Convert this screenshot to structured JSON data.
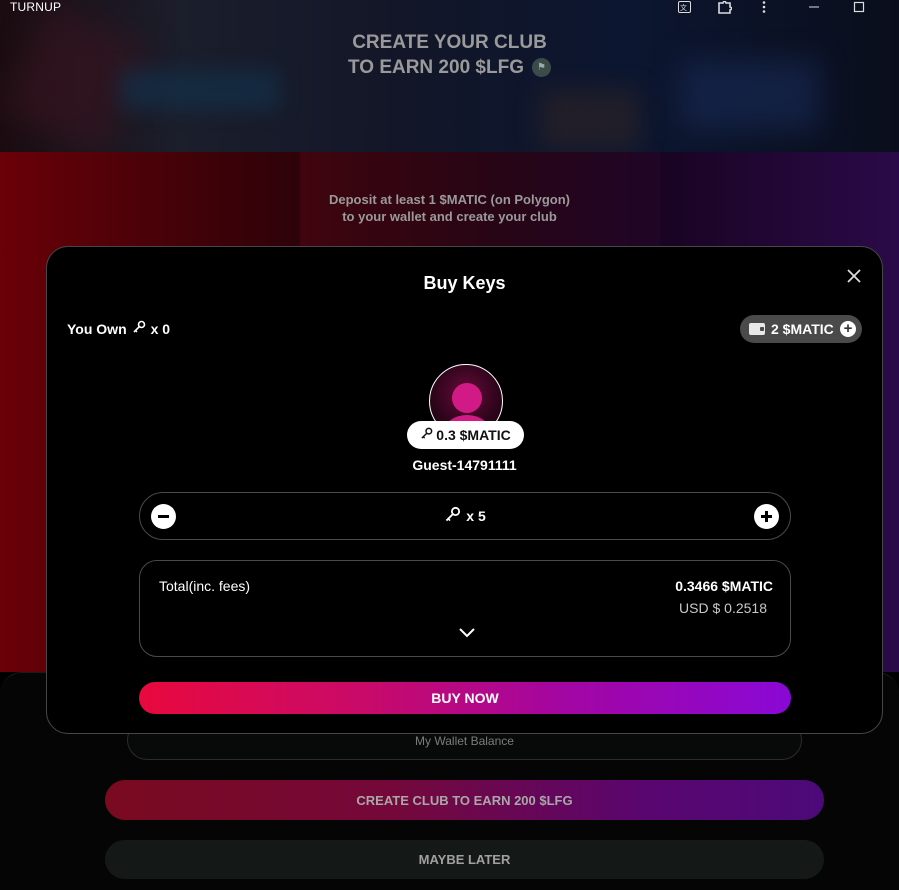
{
  "window": {
    "app_title": "TURNUP",
    "icons": [
      "translate-icon",
      "extension-icon",
      "more-vert-icon",
      "minimize-icon",
      "maximize-icon"
    ]
  },
  "hero": {
    "title_line1": "CREATE YOUR CLUB",
    "title_line2": "TO EARN 200 $LFG"
  },
  "deposit": {
    "line1": "Deposit at least 1 $MATIC (on Polygon)",
    "line2": "to your wallet and create your club"
  },
  "modal": {
    "title": "Buy Keys",
    "you_own_label": "You Own",
    "you_own_count": "x 0",
    "wallet_balance": "2 $MATIC",
    "key_price": "0.3 $MATIC",
    "guest_name": "Guest-14791111",
    "quantity": "x 5",
    "total_label": "Total(inc. fees)",
    "total_matic": "0.3466 $MATIC",
    "total_usd": "USD $ 0.2518",
    "buy_label": "BUY NOW"
  },
  "lower": {
    "wallet_balance_label": "My Wallet Balance",
    "create_label": "CREATE CLUB TO EARN 200 $LFG",
    "maybe_label": "MAYBE LATER"
  },
  "colors": {
    "buy_gradient_start": "#e8093e",
    "buy_gradient_end": "#8a08d6",
    "avatar_accent": "#d21a86"
  }
}
